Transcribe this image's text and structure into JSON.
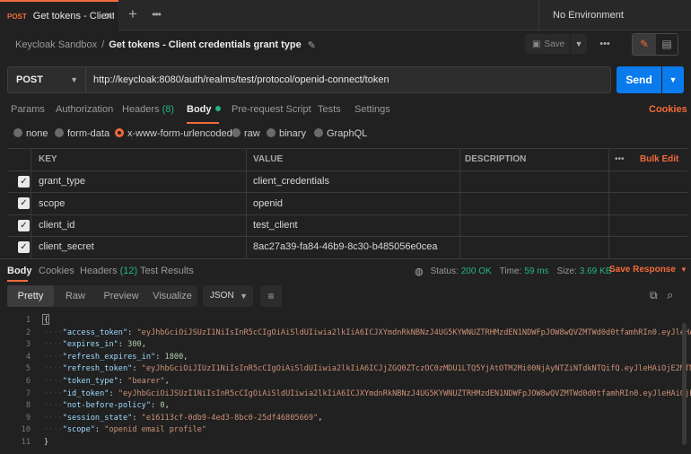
{
  "tab": {
    "method": "POST",
    "name": "Get tokens - Client credentials grant type"
  },
  "environment": {
    "selected": "No Environment"
  },
  "breadcrumb": {
    "collection": "Keycloak Sandbox",
    "separator": "/",
    "request": "Get tokens - Client credentials grant type"
  },
  "toolbar": {
    "save_label": "Save"
  },
  "request": {
    "method": "POST",
    "url": "http://keycloak:8080/auth/realms/test/protocol/openid-connect/token",
    "send_label": "Send"
  },
  "request_tabs": {
    "params": "Params",
    "authorization": "Authorization",
    "headers": "Headers",
    "headers_count": "(8)",
    "body": "Body",
    "prerequest": "Pre-request Script",
    "tests": "Tests",
    "settings": "Settings",
    "cookies": "Cookies"
  },
  "body_types": {
    "none": "none",
    "form_data": "form-data",
    "urlencoded": "x-www-form-urlencoded",
    "raw": "raw",
    "binary": "binary",
    "graphql": "GraphQL",
    "selected": "x-www-form-urlencoded"
  },
  "params_table": {
    "headers": {
      "key": "KEY",
      "value": "VALUE",
      "description": "DESCRIPTION",
      "bulk_edit": "Bulk Edit"
    },
    "rows": [
      {
        "key": "grant_type",
        "value": "client_credentials",
        "checked": true
      },
      {
        "key": "scope",
        "value": "openid",
        "checked": true
      },
      {
        "key": "client_id",
        "value": "test_client",
        "checked": true
      },
      {
        "key": "client_secret",
        "value": "8ac27a39-fa84-46b9-8c30-b485056e0cea",
        "checked": true
      }
    ]
  },
  "response_tabs": {
    "body": "Body",
    "cookies": "Cookies",
    "headers": "Headers",
    "headers_count": "(12)",
    "test_results": "Test Results"
  },
  "response_status": {
    "status_label": "Status:",
    "status": "200 OK",
    "time_label": "Time:",
    "time": "59 ms",
    "size_label": "Size:",
    "size": "3.69 KB",
    "save_response": "Save Response"
  },
  "format": {
    "pretty": "Pretty",
    "raw": "Raw",
    "preview": "Preview",
    "visualize": "Visualize",
    "lang": "JSON"
  },
  "code_lines": [
    {
      "n": "1",
      "text": "{"
    },
    {
      "n": "2",
      "key": "\"access_token\"",
      "val": "\"eyJhbGciOiJSUzI1NiIsInR5cCIgOiAiSldUIiwia2lkIiA6ICJXYmdnRkNBNzJ4UG5KYWNUZTRHMzdEN1NDWFpJOW8wQVZMTWd0d0tfamhRIn0.eyJleHAiOjE",
      "type": "s"
    },
    {
      "n": "3",
      "key": "\"expires_in\"",
      "val": "300",
      "type": "n"
    },
    {
      "n": "4",
      "key": "\"refresh_expires_in\"",
      "val": "1800",
      "type": "n"
    },
    {
      "n": "5",
      "key": "\"refresh_token\"",
      "val": "\"eyJhbGciOiJIUzI1NiIsInR5cCIgOiAiSldUIiwia2lkIiA6ICJjZGQ0ZTczOC0zMDU1LTQ5YjAtOTM2Mi00NjAyNTZiNTdkNTQifQ.eyJleHAiOjE2MTM2Mjk",
      "type": "s"
    },
    {
      "n": "6",
      "key": "\"token_type\"",
      "val": "\"bearer\"",
      "type": "s"
    },
    {
      "n": "7",
      "key": "\"id_token\"",
      "val": "\"eyJhbGciOiJSUzI1NiIsInR5cCIgOiAiSldUIiwia2lkIiA6ICJXYmdnRkNBNzJ4UG5KYWNUZTRHMzdEN1NDWFpJOW8wQVZMTWd0d0tfamhRIn0.eyJleHAiOjE2MTM",
      "type": "s"
    },
    {
      "n": "8",
      "key": "\"not-before-policy\"",
      "val": "0",
      "type": "n"
    },
    {
      "n": "9",
      "key": "\"session_state\"",
      "val": "\"e16113cf-0db9-4ed3-8bc0-25df46805669\"",
      "type": "s"
    },
    {
      "n": "10",
      "key": "\"scope\"",
      "val": "\"openid email profile\"",
      "type": "s",
      "last": true
    },
    {
      "n": "11",
      "text": "}"
    }
  ]
}
